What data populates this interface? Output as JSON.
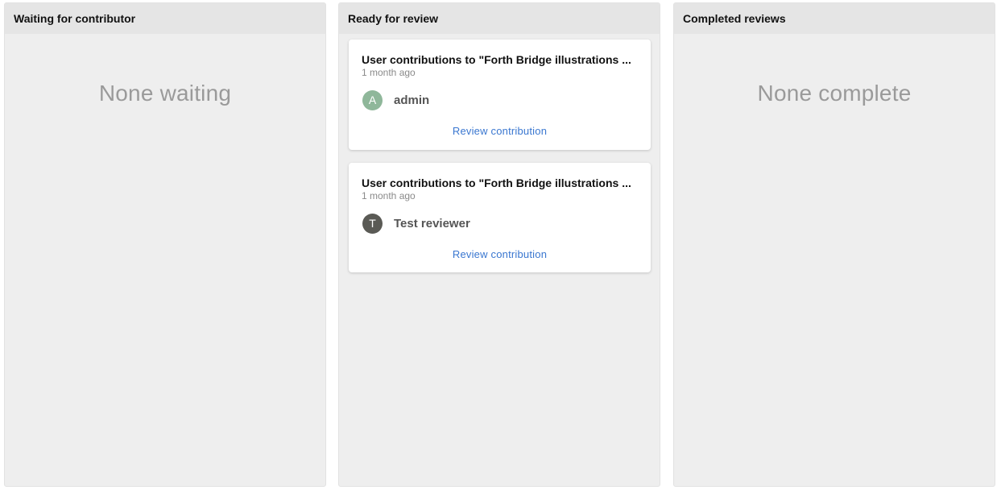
{
  "columns": [
    {
      "title": "Waiting for contributor",
      "empty_text": "None waiting"
    },
    {
      "title": "Ready for review",
      "cards": [
        {
          "title": "User contributions to \"Forth Bridge illustrations ...",
          "time": "1 month ago",
          "avatar_letter": "A",
          "avatar_color": "#8fb79a",
          "user": "admin",
          "link_label": "Review contribution"
        },
        {
          "title": "User contributions to \"Forth Bridge illustrations ...",
          "time": "1 month ago",
          "avatar_letter": "T",
          "avatar_color": "#5a5a55",
          "user": "Test reviewer",
          "link_label": "Review contribution"
        }
      ]
    },
    {
      "title": "Completed reviews",
      "empty_text": "None complete"
    }
  ]
}
